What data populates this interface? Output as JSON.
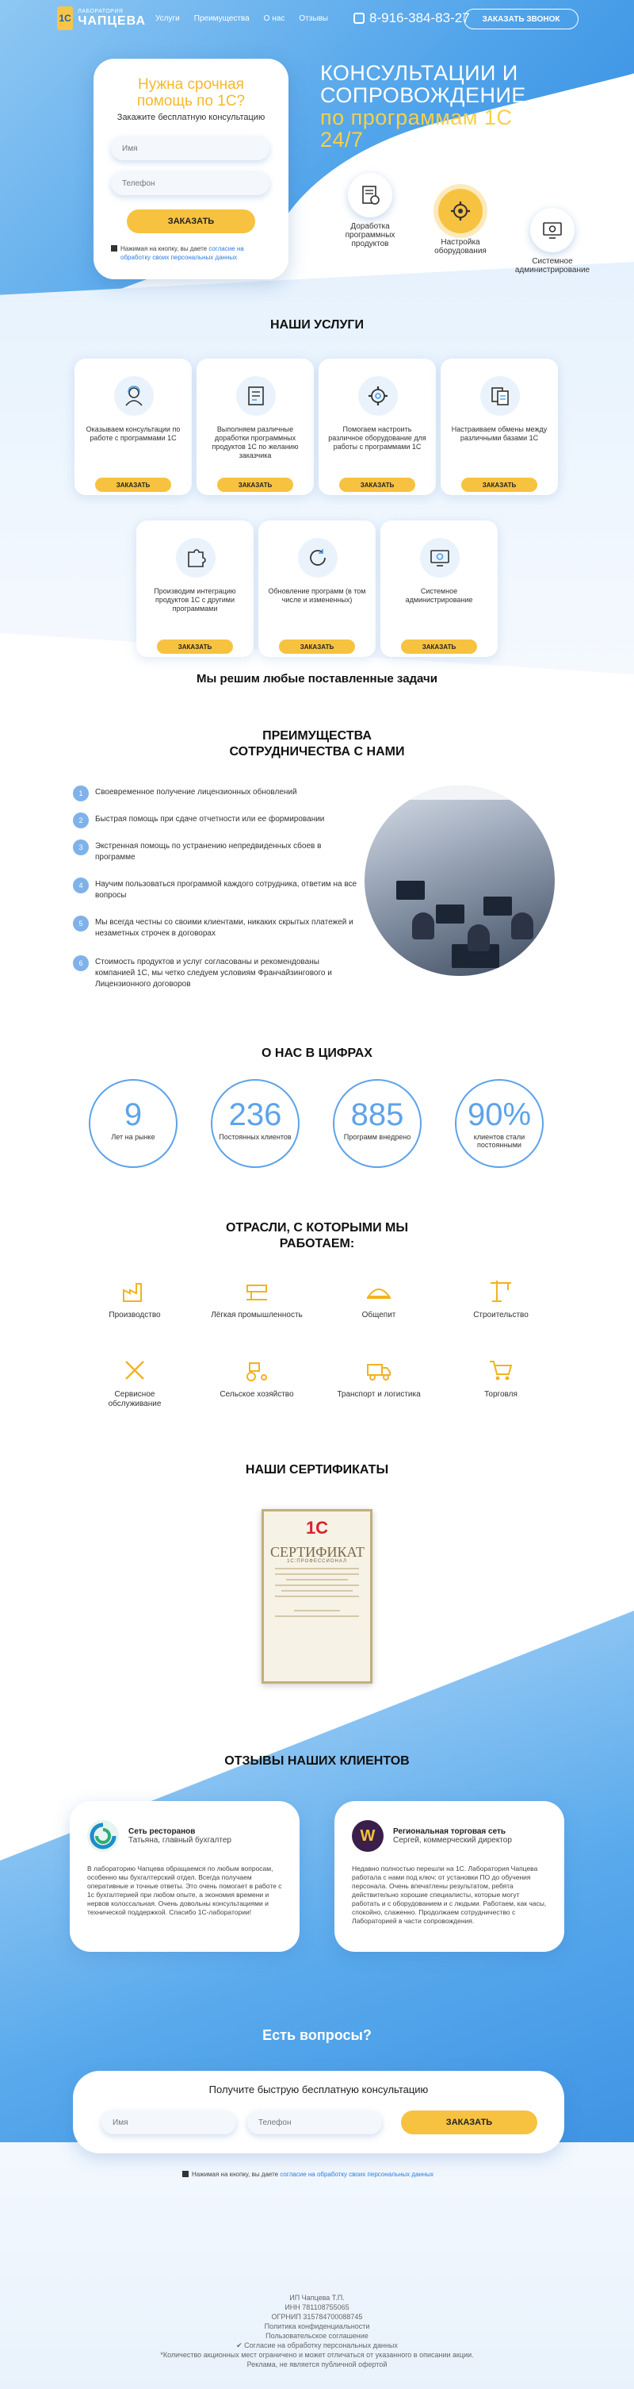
{
  "header": {
    "logo_small": "ЛАБОРАТОРИЯ",
    "logo_big": "ЧАПЦЕВА",
    "logo_mark": "1С",
    "nav": [
      "Услуги",
      "Преимущества",
      "О нас",
      "Отзывы"
    ],
    "phone": "8-916-384-83-27",
    "call_button": "ЗАКАЗАТЬ ЗВОНОК"
  },
  "hero": {
    "card_title": "Нужна срочная помощь по 1С?",
    "card_subtitle": "Закажите бесплатную консультацию",
    "name_placeholder": "Имя",
    "phone_placeholder": "Телефон",
    "order_button": "ЗАКАЗАТЬ",
    "consent_text": "Нажимая на кнопку, вы даете ",
    "consent_link": "согласие на обработку своих персональных данных",
    "headline_line1": "КОНСУЛЬТАЦИИ И",
    "headline_line2": "СОПРОВОЖДЕНИЕ",
    "headline_yellow1": "по программам 1С",
    "headline_yellow2": "24/7",
    "features": [
      {
        "label": "Доработка программных продуктов",
        "icon": "document-gear-icon"
      },
      {
        "label": "Настройка оборудования",
        "icon": "gear-icon"
      },
      {
        "label": "Системное администрирование",
        "icon": "monitor-gear-icon"
      }
    ]
  },
  "services": {
    "title": "НАШИ УСЛУГИ",
    "button_label": "ЗАКАЗАТЬ",
    "items": [
      {
        "text": "Оказываем консультации по работе с программами 1С",
        "icon": "consultant-icon"
      },
      {
        "text": "Выполняем различные доработки программных продуктов 1С по желанию заказчика",
        "icon": "checklist-icon"
      },
      {
        "text": "Помогаем настроить различное оборудование для работы с программами 1С",
        "icon": "gear-icon"
      },
      {
        "text": "Настраиваем обмены между различными базами 1С",
        "icon": "documents-exchange-icon"
      },
      {
        "text": "Производим интеграцию продуктов 1С с другими программами",
        "icon": "puzzle-icon"
      },
      {
        "text": "Обновление программ (в том числе и измененных)",
        "icon": "update-icon"
      },
      {
        "text": "Системное администрирование",
        "icon": "monitor-gear-icon"
      }
    ],
    "slogan": "Мы решим любые поставленные задачи"
  },
  "advantages": {
    "title_line1": "ПРЕИМУЩЕСТВА",
    "title_line2": "СОТРУДНИЧЕСТВА С НАМИ",
    "items": [
      {
        "num": "1",
        "text": "Своевременное получение лицензионных обновлений"
      },
      {
        "num": "2",
        "text": "Быстрая помощь при сдаче отчетности или ее формировании"
      },
      {
        "num": "3",
        "text": "Экстренная помощь по устранению непредвиденных сбоев в программе"
      },
      {
        "num": "4",
        "text": "Научим пользоваться программой каждого сотрудника, ответим на все вопросы"
      },
      {
        "num": "5",
        "text": "Мы всегда честны со своими клиентами, никаких скрытых платежей и незаметных строчек в договорах"
      },
      {
        "num": "6",
        "text": "Стоимость продуктов и услуг согласованы и рекомендованы компанией 1С, мы четко следуем условиям Франчайзингового и Лицензионного договоров"
      }
    ]
  },
  "numbers": {
    "title": "О НАС В ЦИФРАХ",
    "items": [
      {
        "value": "9",
        "label": "Лет на рынке"
      },
      {
        "value": "236",
        "label": "Постоянных клиентов"
      },
      {
        "value": "885",
        "label": "Программ внедрено"
      },
      {
        "value": "90%",
        "label": "клиентов стали постоянными"
      }
    ]
  },
  "industries": {
    "title_line1": "ОТРАСЛИ, С КОТОРЫМИ МЫ",
    "title_line2": "РАБОТАЕМ:",
    "items": [
      {
        "label": "Производство",
        "icon": "factory-icon"
      },
      {
        "label": "Лёгкая промышленность",
        "icon": "sewing-icon"
      },
      {
        "label": "Общепит",
        "icon": "food-icon"
      },
      {
        "label": "Строительство",
        "icon": "crane-icon"
      },
      {
        "label": "Сервисное обслуживание",
        "icon": "tools-icon"
      },
      {
        "label": "Сельское хозяйство",
        "icon": "tractor-icon"
      },
      {
        "label": "Транспорт и логистика",
        "icon": "truck-icon"
      },
      {
        "label": "Торговля",
        "icon": "cart-icon"
      }
    ]
  },
  "certificates": {
    "title": "НАШИ СЕРТИФИКАТЫ",
    "cert_logo": "1С",
    "cert_title": "СЕРТИФИКАТ",
    "cert_subtitle": "1С:ПРОФЕССИОНАЛ"
  },
  "reviews": {
    "title": "ОТЗЫВЫ НАШИХ КЛИЕНТОВ",
    "items": [
      {
        "name": "Сеть ресторанов",
        "role": "Татьяна, главный бухгалтер",
        "text": "В лабораторию Чапцева обращаемся по любым вопросам, особенно мы бухгалтерский отдел. Всегда получаем оперативные и точные ответы. Это очень помогает в работе с 1с бухгалтерией при любом опыте, а экономия времени и нервов колоссальная. Очень довольны консультациями и технической поддержкой. Спасибо 1С-лаборатории!"
      },
      {
        "name": "Региональная торговая сеть",
        "role": "Сергей, коммерческий директор",
        "text": "Недавно полностью перешли на 1С. Лаборатория Чапцева работала с нами под ключ: от установки ПО до обучения персонала. Очень впечатлены результатом, ребята действительно хорошие специалисты, которые могут работать и с оборудованием и с людьми. Работаем, как часы, спокойно, слаженно. Продолжаем сотрудничество с Лабораторией в части сопровождения."
      }
    ]
  },
  "questions": {
    "title": "Есть вопросы?",
    "card_title": "Получите быструю бесплатную консультацию",
    "name_placeholder": "Имя",
    "phone_placeholder": "Телефон",
    "button": "ЗАКАЗАТЬ",
    "consent_text": "Нажимая на кнопку, вы даете ",
    "consent_link": "согласие на обработку своих персональных данных"
  },
  "footer": {
    "lines": [
      "ИП Чапцева Т.П.",
      "ИНН 781108755065",
      "ОГРНИП 315784700088745",
      "Политика конфиденциальности",
      "Пользовательское соглашение",
      "✔ Согласие на обработку персональных данных",
      "*Количество акционных мест ограничено и может отличаться от указанного в описании акции.",
      "Реклама, не является публичной офертой"
    ]
  },
  "colors": {
    "accent_yellow": "#f7c240",
    "accent_blue": "#5da3ea",
    "link_blue": "#2a7de1"
  }
}
